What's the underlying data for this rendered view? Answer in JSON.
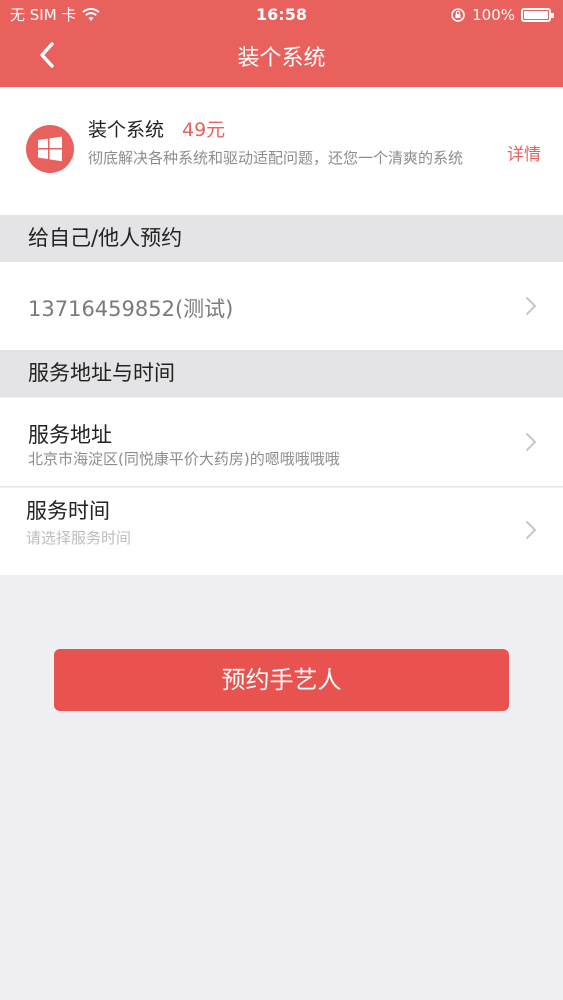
{
  "status_bar": {
    "carrier": "无 SIM 卡",
    "time": "16:58",
    "battery": "100%",
    "battery_level": 1.0
  },
  "nav": {
    "title": "装个系统",
    "back_icon": "chevron-left-icon"
  },
  "product": {
    "icon": "windows-logo-icon",
    "name": "装个系统",
    "price": "49元",
    "description": "彻底解决各种系统和驱动适配问题，还您一个清爽的系统",
    "detail_label": "详情"
  },
  "booking_section": {
    "header": "给自己/他人预约",
    "contact": "13716459852(测试)"
  },
  "service_section": {
    "header": "服务地址与时间",
    "address_label": "服务地址",
    "address_value": "北京市海淀区(同悦康平价大药房)的嗯哦哦哦哦",
    "time_label": "服务时间",
    "time_placeholder": "请选择服务时间"
  },
  "actions": {
    "book_label": "预约手艺人"
  },
  "colors": {
    "accent": "#e9615d",
    "button": "#e9534f",
    "background": "#efeff4"
  }
}
